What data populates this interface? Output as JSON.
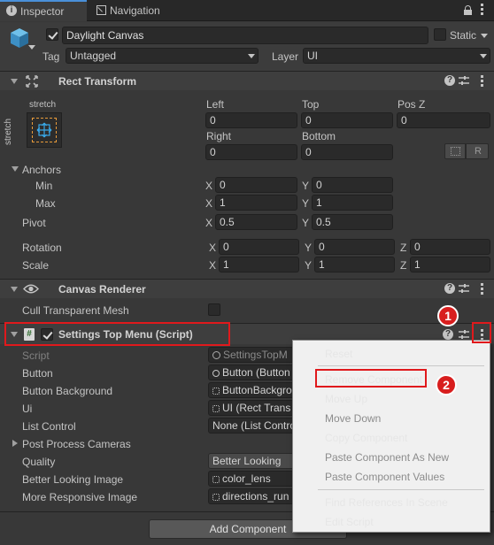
{
  "tabs": {
    "inspector": "Inspector",
    "navigation": "Navigation"
  },
  "object": {
    "name": "Daylight Canvas",
    "static_label": "Static",
    "tag_label": "Tag",
    "tag_value": "Untagged",
    "layer_label": "Layer",
    "layer_value": "UI"
  },
  "rect_transform": {
    "title": "Rect Transform",
    "stretch_h": "stretch",
    "stretch_v": "stretch",
    "left_label": "Left",
    "left_value": "0",
    "top_label": "Top",
    "top_value": "0",
    "posz_label": "Pos Z",
    "posz_value": "0",
    "right_label": "Right",
    "right_value": "0",
    "bottom_label": "Bottom",
    "bottom_value": "0",
    "r_button": "R",
    "anchors_label": "Anchors",
    "min_label": "Min",
    "min_x": "0",
    "min_y": "0",
    "max_label": "Max",
    "max_x": "1",
    "max_y": "1",
    "pivot_label": "Pivot",
    "pivot_x": "0.5",
    "pivot_y": "0.5",
    "rotation_label": "Rotation",
    "rot_x": "0",
    "rot_y": "0",
    "rot_z": "0",
    "scale_label": "Scale",
    "scale_x": "1",
    "scale_y": "1",
    "scale_z": "1",
    "axis_x": "X",
    "axis_y": "Y",
    "axis_z": "Z"
  },
  "canvas_renderer": {
    "title": "Canvas Renderer",
    "cull_label": "Cull Transparent Mesh"
  },
  "script_comp": {
    "title": "Settings Top Menu (Script)",
    "script_label": "Script",
    "script_value": "SettingsTopM",
    "button_label": "Button",
    "button_value": "Button (Button",
    "button_bg_label": "Button Background",
    "button_bg_value": "ButtonBackgro",
    "ui_label": "Ui",
    "ui_value": "UI (Rect Trans",
    "list_control_label": "List Control",
    "list_control_value": "None (List Contro",
    "post_process_label": "Post Process Cameras",
    "quality_label": "Quality",
    "quality_value": "Better Looking",
    "better_img_label": "Better Looking Image",
    "better_img_value": "color_lens",
    "more_resp_label": "More Responsive Image",
    "more_resp_value": "directions_run"
  },
  "add_component": "Add Component",
  "context_menu": {
    "items": [
      {
        "label": "Reset",
        "enabled": true
      },
      {
        "label": "Remove Component",
        "enabled": true
      },
      {
        "label": "Move Up",
        "enabled": true
      },
      {
        "label": "Move Down",
        "enabled": false
      },
      {
        "label": "Copy Component",
        "enabled": true
      },
      {
        "label": "Paste Component As New",
        "enabled": false
      },
      {
        "label": "Paste Component Values",
        "enabled": false
      },
      {
        "label": "Find References In Scene",
        "enabled": true
      },
      {
        "label": "Edit Script",
        "enabled": true
      }
    ]
  },
  "annotations": {
    "badge1": "1",
    "badge2": "2",
    "highlight_color": "#e0191c"
  },
  "colors": {
    "panel_bg": "#383838",
    "header_bg": "#3e3e3e",
    "field_bg": "#2a2a2a",
    "menu_bg": "#f0f0f0",
    "anchor_accent": "#39a7e6"
  }
}
